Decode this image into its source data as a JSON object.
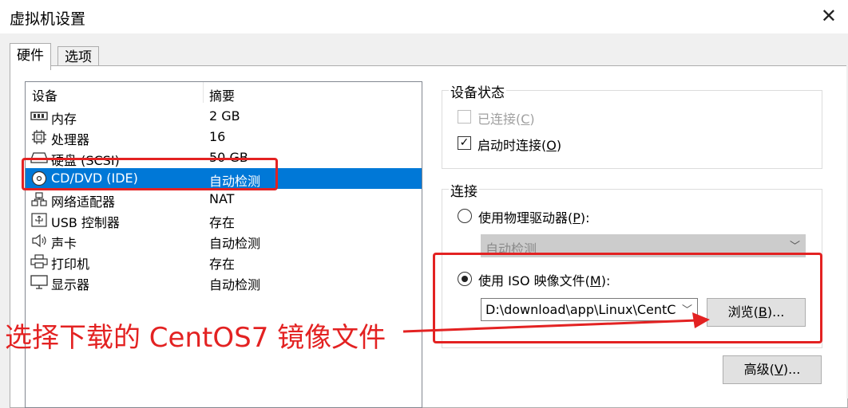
{
  "window": {
    "title": "虚拟机设置"
  },
  "tabs": [
    {
      "label": "硬件"
    },
    {
      "label": "选项"
    }
  ],
  "device_list": {
    "headers": {
      "device": "设备",
      "summary": "摘要"
    },
    "rows": [
      {
        "name": "内存",
        "value": "2 GB",
        "icon": "memory-icon"
      },
      {
        "name": "处理器",
        "value": "16",
        "icon": "processor-icon"
      },
      {
        "name": "硬盘 (SCSI)",
        "value": "50 GB",
        "icon": "hard-disk-icon"
      },
      {
        "name": "CD/DVD (IDE)",
        "value": "自动检测",
        "icon": "cd-dvd-icon",
        "selected": true
      },
      {
        "name": "网络适配器",
        "value": "NAT",
        "icon": "network-adapter-icon"
      },
      {
        "name": "USB 控制器",
        "value": "存在",
        "icon": "usb-icon"
      },
      {
        "name": "声卡",
        "value": "自动检测",
        "icon": "speaker-icon"
      },
      {
        "name": "打印机",
        "value": "存在",
        "icon": "printer-icon"
      },
      {
        "name": "显示器",
        "value": "自动检测",
        "icon": "display-icon"
      }
    ]
  },
  "device_status": {
    "label": "设备状态",
    "connected": {
      "label": "已连接(",
      "key": "C",
      "suffix": ")",
      "checked": false,
      "disabled": true
    },
    "connect_at_power_on": {
      "label": "启动时连接(",
      "key": "O",
      "suffix": ")",
      "checked": true
    }
  },
  "connection": {
    "label": "连接",
    "physical_drive": {
      "label": "使用物理驱动器(",
      "key": "P",
      "suffix": "):",
      "selected": false
    },
    "physical_drive_value": "自动检测",
    "iso_image": {
      "label": "使用 ISO 映像文件(",
      "key": "M",
      "suffix": "):",
      "selected": true
    },
    "iso_path": "D:\\download\\app\\Linux\\CentC",
    "browse": {
      "label": "浏览(",
      "key": "B",
      "suffix": ")..."
    },
    "advanced": {
      "label": "高级(",
      "key": "V",
      "suffix": ")..."
    }
  },
  "annotation": {
    "text": "选择下载的 CentOS7 镜像文件"
  },
  "colors": {
    "selection": "#0078d7",
    "annotation": "#e32222"
  }
}
